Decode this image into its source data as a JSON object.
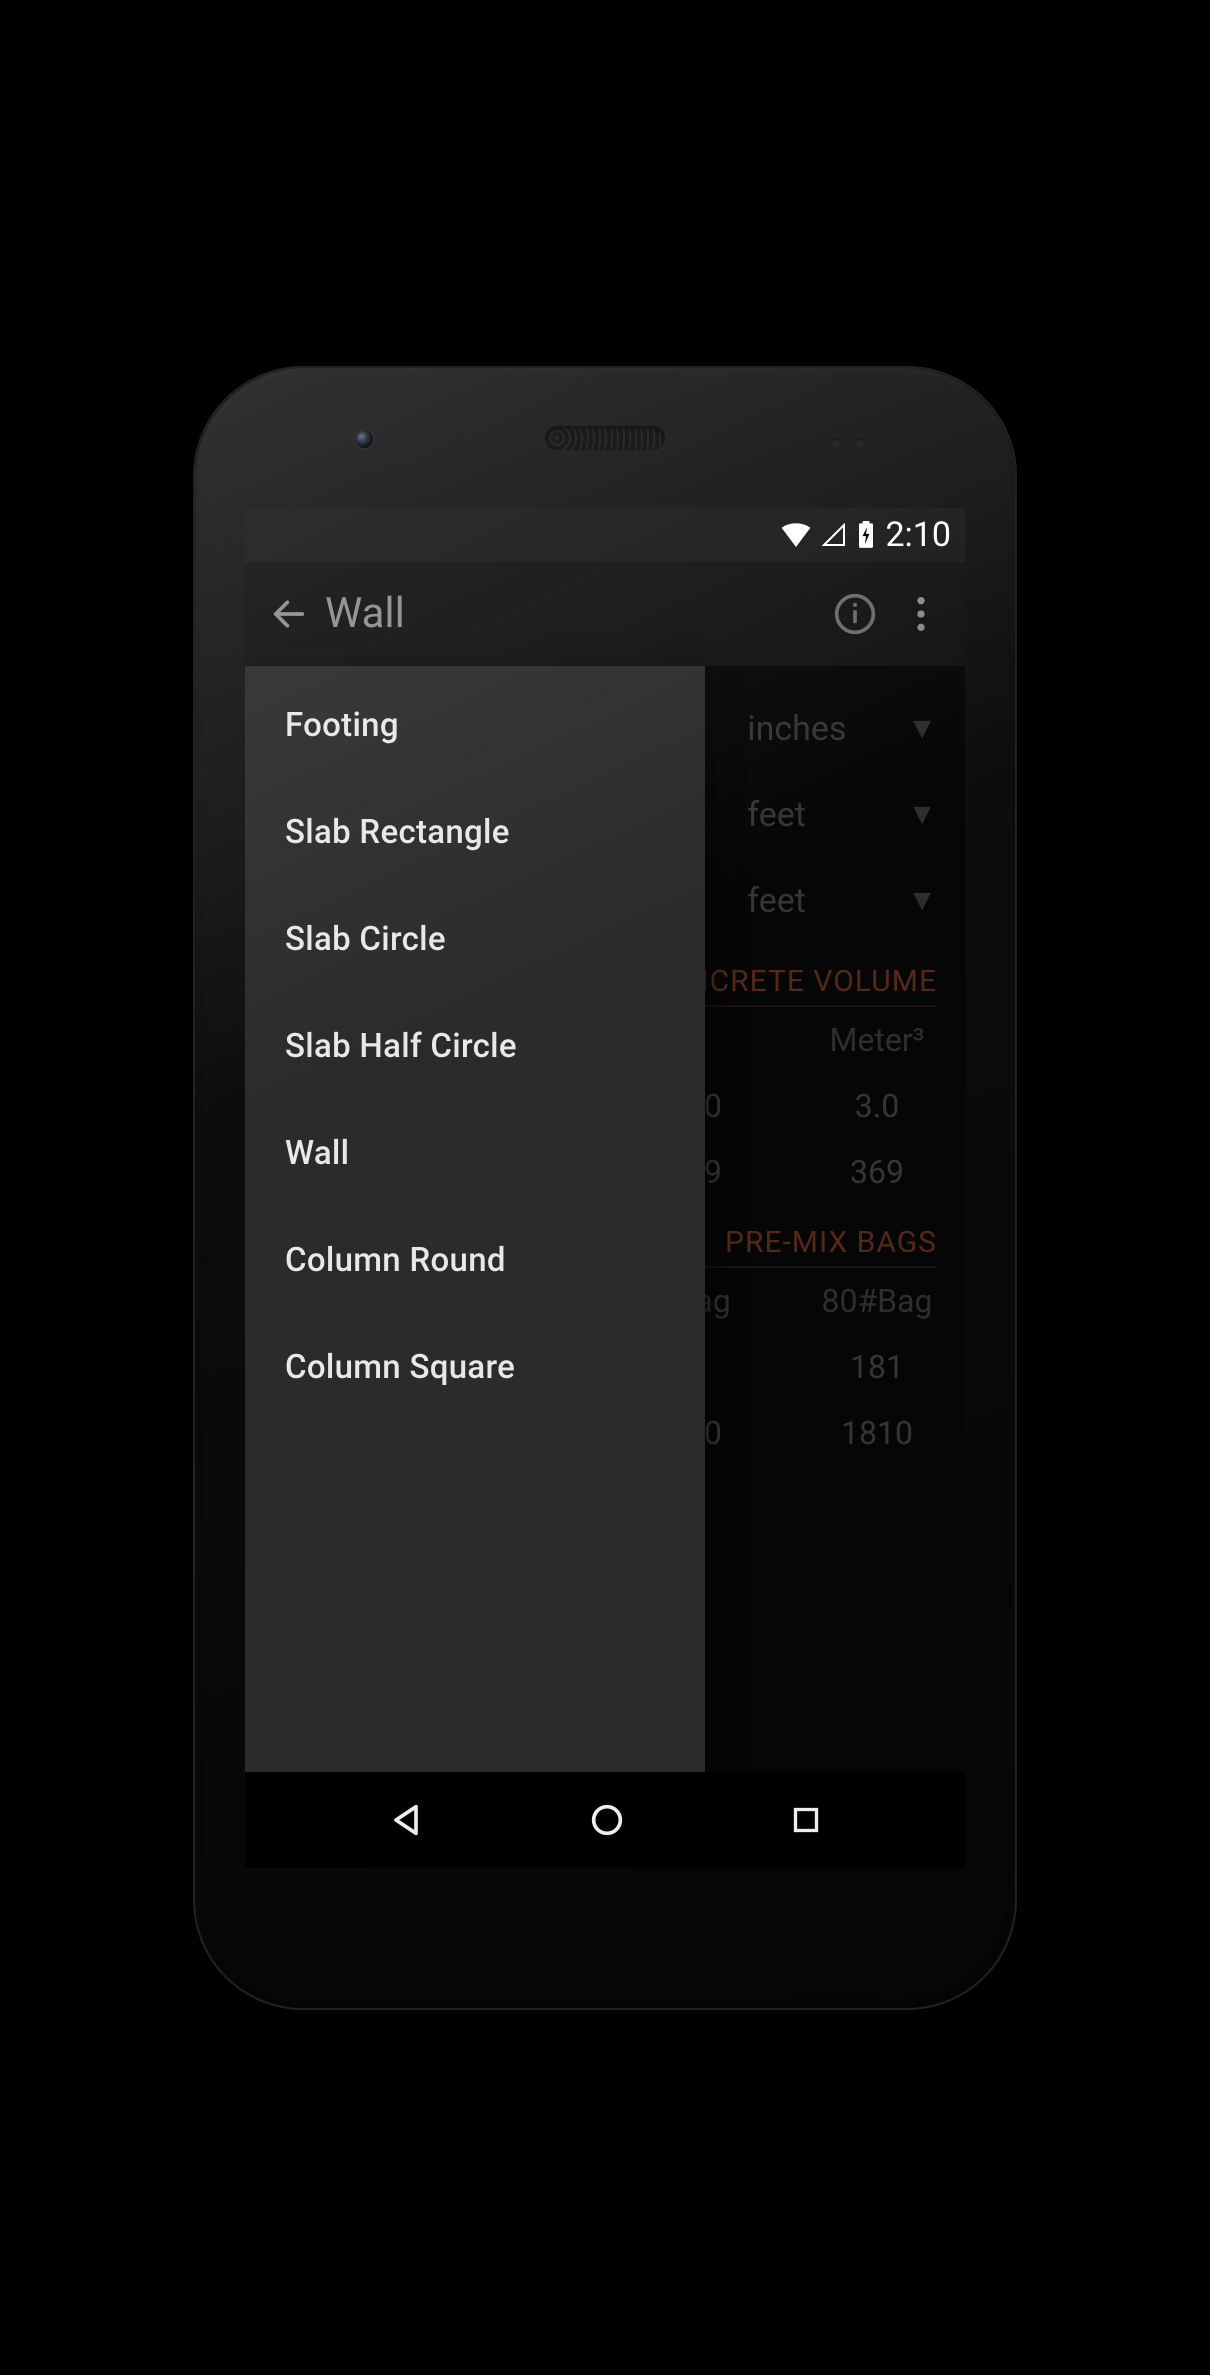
{
  "statusbar": {
    "time": "2:10"
  },
  "appbar": {
    "title": "Wall"
  },
  "units": {
    "row1": "inches",
    "row2": "feet",
    "row3": "feet"
  },
  "sections": {
    "volume": {
      "title": "CONCRETE VOLUME",
      "headers": [
        "",
        "Meter³"
      ],
      "rows": [
        [
          "0",
          "3.0"
        ],
        [
          "9",
          "369"
        ]
      ]
    },
    "bags": {
      "title": "PRE-MIX BAGS",
      "headers": [
        "ag",
        "80#Bag"
      ],
      "rows": [
        [
          "",
          "181"
        ],
        [
          "0",
          "1810"
        ]
      ]
    }
  },
  "menu": {
    "items": [
      "Footing",
      "Slab Rectangle",
      "Slab Circle",
      "Slab Half Circle",
      "Wall",
      "Column Round",
      "Column Square"
    ]
  }
}
